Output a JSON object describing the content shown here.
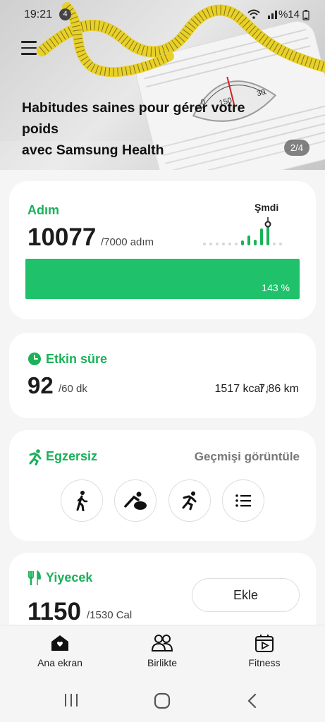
{
  "status": {
    "time": "19:21",
    "notification_count": "4",
    "battery": "%14"
  },
  "banner": {
    "title_line1": "Habitudes saines pour gérer votre",
    "title_line2": "poids",
    "title_line3": "avec Samsung Health",
    "page": "2/4",
    "scale_digits": [
      "0",
      "150",
      "30"
    ]
  },
  "steps": {
    "title": "Adım",
    "value": "10077",
    "goal": "/7000 adım",
    "now_label": "Şmdi",
    "percent_text": "143 %",
    "progress_fraction": 1.0
  },
  "active_time": {
    "title": "Etkin süre",
    "value": "92",
    "goal": "/60 dk",
    "kcal": "1517 kcal",
    "distance": "7,86 km"
  },
  "exercise": {
    "title": "Egzersiz",
    "history_link": "Geçmişi görüntüle",
    "buttons": [
      "walking-icon",
      "yoga-icon",
      "running-icon",
      "list-icon"
    ]
  },
  "food": {
    "title": "Yiyecek",
    "value": "1150",
    "goal": "/1530 Cal",
    "add_label": "Ekle"
  },
  "nav": {
    "home": "Ana ekran",
    "together": "Birlikte",
    "fitness": "Fitness"
  },
  "colors": {
    "accent": "#1ab159",
    "progress": "#1fc16b"
  }
}
